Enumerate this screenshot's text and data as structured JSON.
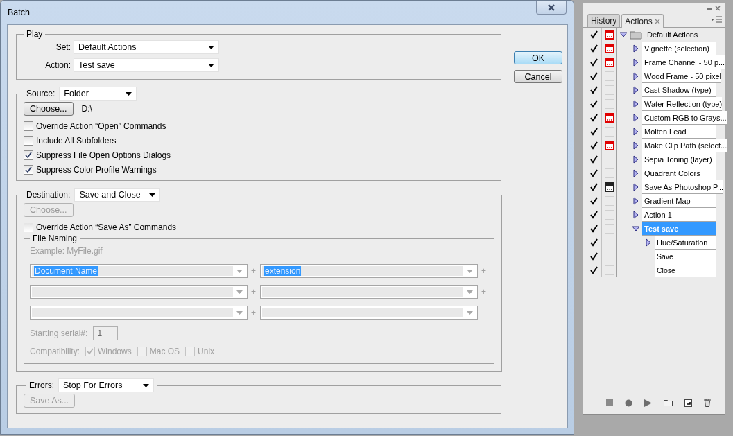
{
  "window": {
    "title": "Batch"
  },
  "play": {
    "title": "Play",
    "set": {
      "label": "Set:",
      "value": "Default Actions"
    },
    "action": {
      "label": "Action:",
      "value": "Test save"
    }
  },
  "source": {
    "label": "Source:",
    "value": "Folder",
    "choose_button": {
      "label": "Choose...",
      "disabled": false
    },
    "path": "D:\\",
    "options": [
      {
        "label": "Override Action “Open” Commands",
        "checked": false
      },
      {
        "label": "Include All Subfolders",
        "checked": false
      },
      {
        "label": "Suppress File Open Options Dialogs",
        "checked": true
      },
      {
        "label": "Suppress Color Profile Warnings",
        "checked": true
      }
    ]
  },
  "destination": {
    "label": "Destination:",
    "value": "Save and Close",
    "choose_button": {
      "label": "Choose...",
      "disabled": true
    },
    "override": {
      "label": "Override Action “Save As” Commands",
      "checked": false
    },
    "file_naming": {
      "title": "File Naming",
      "disabled": true,
      "example": "Example: MyFile.gif",
      "rows": [
        {
          "cells": [
            {
              "value": "Document Name",
              "highlighted": true
            },
            {
              "value": "extension",
              "highlighted": true
            }
          ],
          "separators": [
            "+",
            "+"
          ]
        },
        {
          "cells": [
            {
              "highlighted": false
            },
            {
              "highlighted": false
            }
          ],
          "separators": [
            "+",
            "+"
          ]
        },
        {
          "cells": [
            {
              "highlighted": false
            },
            {
              "highlighted": false
            }
          ],
          "separators": [
            "+"
          ]
        }
      ],
      "serial": {
        "label": "Starting serial#:",
        "value": "1"
      },
      "compatibility": {
        "label": "Compatibility:",
        "options": [
          {
            "label": "Windows",
            "checked": true
          },
          {
            "label": "Mac OS",
            "checked": false
          },
          {
            "label": "Unix",
            "checked": false
          }
        ]
      }
    }
  },
  "errors": {
    "label": "Errors:",
    "value": "Stop For Errors",
    "save_as_button": {
      "label": "Save As...",
      "disabled": true
    }
  },
  "buttons": [
    {
      "label": "OK",
      "default": true
    },
    {
      "label": "Cancel",
      "default": false
    }
  ],
  "actions_panel": {
    "tabs": [
      {
        "label": "History",
        "selected": false
      },
      {
        "label": "Actions",
        "selected": true
      }
    ],
    "items": [
      {
        "kind": "set",
        "label": "Default Actions",
        "enabled": true,
        "dialog_toggle": true,
        "color": "#e00000",
        "expanded": true,
        "selected": false,
        "children": [
          {
            "kind": "action",
            "label": "Vignette (selection)",
            "enabled": true,
            "dialog_toggle": true,
            "color": "#e00000",
            "expanded": false,
            "selected": false
          },
          {
            "kind": "action",
            "label": "Frame Channel - 50 p...",
            "enabled": true,
            "dialog_toggle": true,
            "color": "#e00000",
            "expanded": false,
            "selected": false
          },
          {
            "kind": "action",
            "label": "Wood Frame - 50 pixel",
            "enabled": true,
            "dialog_toggle": false,
            "expanded": false,
            "selected": false
          },
          {
            "kind": "action",
            "label": "Cast Shadow (type)",
            "enabled": true,
            "dialog_toggle": false,
            "expanded": false,
            "selected": false
          },
          {
            "kind": "action",
            "label": "Water Reflection (type)",
            "enabled": true,
            "dialog_toggle": false,
            "expanded": false,
            "selected": false
          },
          {
            "kind": "action",
            "label": "Custom RGB to Grays...",
            "enabled": true,
            "dialog_toggle": true,
            "color": "#e00000",
            "expanded": false,
            "selected": false
          },
          {
            "kind": "action",
            "label": "Molten Lead",
            "enabled": true,
            "dialog_toggle": false,
            "expanded": false,
            "selected": false
          },
          {
            "kind": "action",
            "label": "Make Clip Path (select...",
            "enabled": true,
            "dialog_toggle": true,
            "color": "#e00000",
            "expanded": false,
            "selected": false
          },
          {
            "kind": "action",
            "label": "Sepia Toning (layer)",
            "enabled": true,
            "dialog_toggle": false,
            "expanded": false,
            "selected": false
          },
          {
            "kind": "action",
            "label": "Quadrant Colors",
            "enabled": true,
            "dialog_toggle": false,
            "expanded": false,
            "selected": false
          },
          {
            "kind": "action",
            "label": "Save As Photoshop P...",
            "enabled": true,
            "dialog_toggle": true,
            "color": "#222222",
            "expanded": false,
            "selected": false
          },
          {
            "kind": "action",
            "label": "Gradient Map",
            "enabled": true,
            "dialog_toggle": false,
            "expanded": false,
            "selected": false
          },
          {
            "kind": "action",
            "label": "Action 1",
            "enabled": true,
            "dialog_toggle": false,
            "expanded": false,
            "selected": false
          },
          {
            "kind": "action",
            "label": "Test save",
            "enabled": true,
            "dialog_toggle": false,
            "expanded": true,
            "selected": true,
            "children": [
              {
                "kind": "action",
                "label": "Hue/Saturation",
                "enabled": true,
                "dialog_toggle": false,
                "expanded": false,
                "selected": false
              },
              {
                "kind": "step",
                "label": "Save",
                "enabled": true,
                "dialog_toggle": false,
                "selected": false
              },
              {
                "kind": "step",
                "label": "Close",
                "enabled": true,
                "dialog_toggle": false,
                "selected": false
              }
            ]
          }
        ]
      }
    ]
  }
}
